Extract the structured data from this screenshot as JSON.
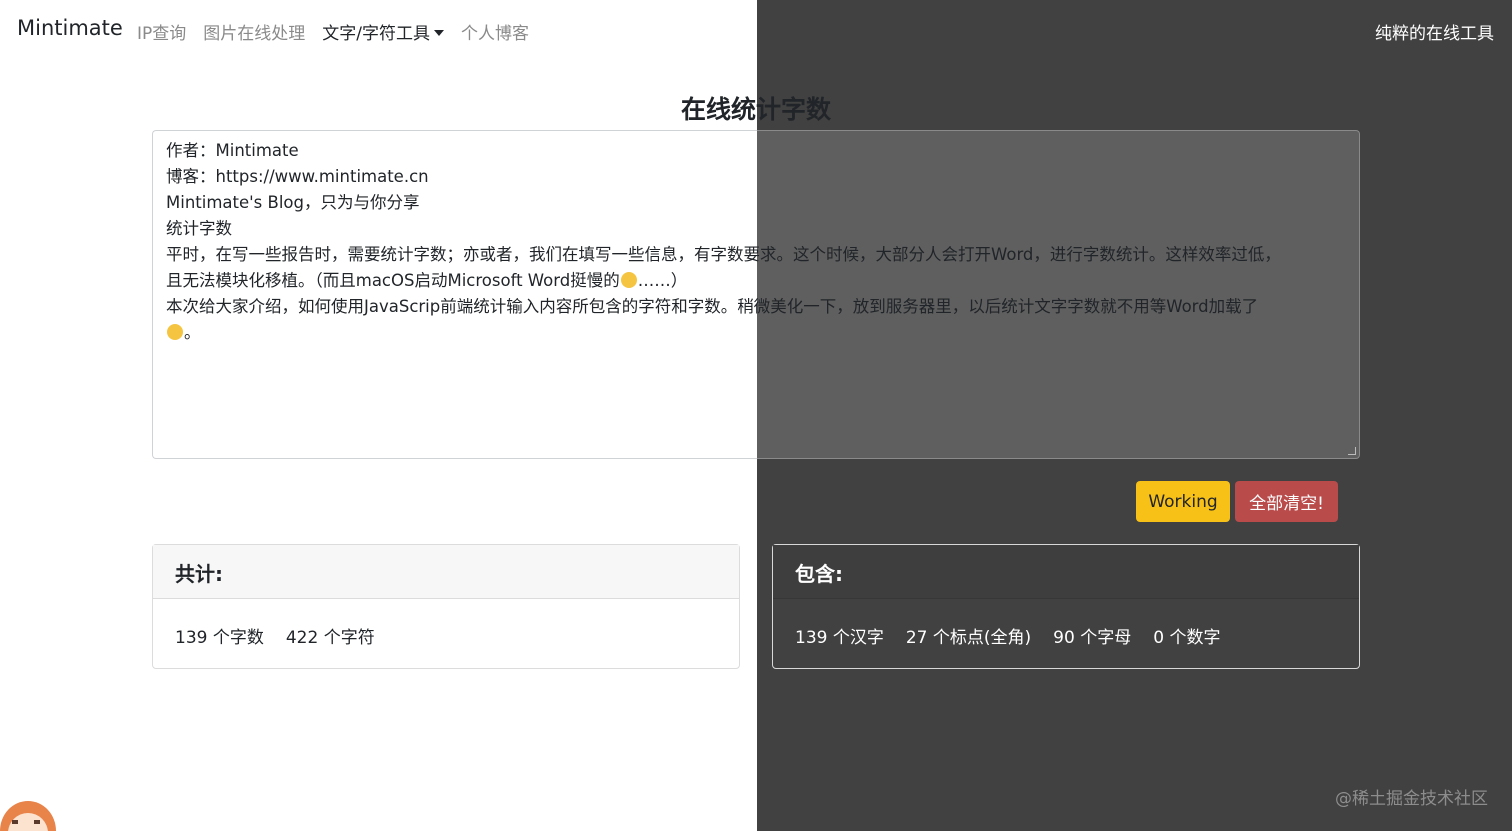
{
  "navbar": {
    "brand": "Mintimate",
    "items": [
      {
        "label": "IP查询"
      },
      {
        "label": "图片在线处理"
      },
      {
        "label": "文字/字符工具"
      },
      {
        "label": "个人博客"
      }
    ],
    "right_label": "纯粹的在线工具"
  },
  "main": {
    "title": "在线统计字数",
    "textarea_lines": [
      "作者：Mintimate",
      "博客：https://www.mintimate.cn",
      "Mintimate's Blog，只为与你分享",
      "统计字数",
      "平时，在写一些报告时，需要统计字数；亦或者，我们在填写一些信息，有字数要求。这个时候，大部分人会打开Word，进行字数统计。这样效率过低，",
      "且无法模块化移植。（而且macOS启动Microsoft Word挺慢的",
      "……）",
      "本次给大家介绍，如何使用JavaScrip前端统计输入内容所包含的字符和字数。稍微美化一下，放到服务器里，以后统计文字字数就不用等Word加载了",
      "。"
    ],
    "buttons": {
      "working": "Working",
      "clear": "全部清空!"
    }
  },
  "cards": {
    "total": {
      "header": "共计:",
      "stats": [
        "139 个字数",
        "422 个字符"
      ]
    },
    "contains": {
      "header": "包含:",
      "stats": [
        "139 个汉字",
        "27 个标点(全角)",
        "90 个字母",
        "0 个数字"
      ]
    }
  },
  "watermark": "@稀土掘金技术社区",
  "colors": {
    "dark_panel": "#414141",
    "working_button": "#f8c118",
    "clear_button": "#b94b4b"
  }
}
